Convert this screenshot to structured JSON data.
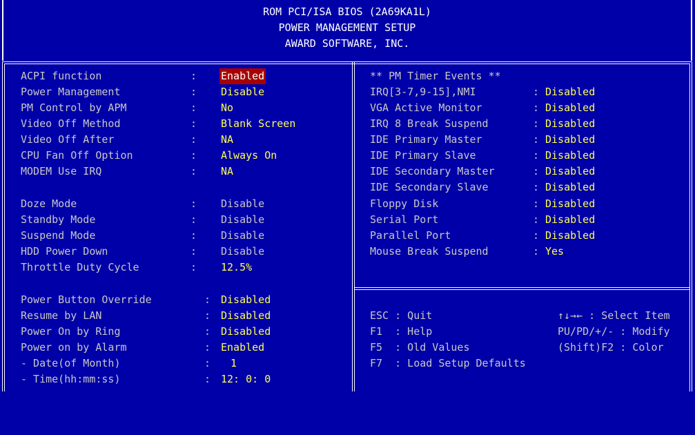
{
  "header": {
    "line1": "ROM PCI/ISA BIOS (2A69KA1L)",
    "line2": "POWER MANAGEMENT SETUP",
    "line3": "AWARD SOFTWARE, INC."
  },
  "left_group1": [
    {
      "label": "ACPI function",
      "value": "Enabled",
      "selected": true
    },
    {
      "label": "Power Management",
      "value": "Disable"
    },
    {
      "label": "PM Control by APM",
      "value": "No"
    },
    {
      "label": "Video Off Method",
      "value": "Blank Screen"
    },
    {
      "label": "Video Off After",
      "value": "NA"
    },
    {
      "label": "CPU Fan Off Option",
      "value": "Always On"
    },
    {
      "label": "MODEM Use IRQ",
      "value": "NA"
    }
  ],
  "left_group2": [
    {
      "label": "Doze Mode",
      "value": "Disable"
    },
    {
      "label": "Standby Mode",
      "value": "Disable"
    },
    {
      "label": "Suspend Mode",
      "value": "Disable"
    },
    {
      "label": "HDD Power Down",
      "value": "Disable"
    },
    {
      "label": "Throttle Duty Cycle",
      "value": "12.5%"
    }
  ],
  "left_group3": [
    {
      "label": "Power Button Override",
      "value": "Disabled"
    },
    {
      "label": "Resume by LAN",
      "value": "Disabled"
    },
    {
      "label": "Power On by Ring",
      "value": "Disabled"
    },
    {
      "label": "Power on by Alarm",
      "value": "Enabled"
    },
    {
      "label": "- Date(of Month)",
      "value": "1"
    },
    {
      "label": "- Time(hh:mm:ss)",
      "value": "12: 0: 0"
    }
  ],
  "right": {
    "title": "** PM Timer Events **",
    "items": [
      {
        "label": "IRQ[3-7,9-15],NMI",
        "value": "Disabled"
      },
      {
        "label": "VGA Active Monitor",
        "value": "Disabled"
      },
      {
        "label": "IRQ 8 Break Suspend",
        "value": "Disabled"
      },
      {
        "label": "IDE Primary Master",
        "value": "Disabled"
      },
      {
        "label": "IDE Primary Slave",
        "value": "Disabled"
      },
      {
        "label": "IDE Secondary Master",
        "value": "Disabled"
      },
      {
        "label": "IDE Secondary Slave",
        "value": "Disabled"
      },
      {
        "label": "Floppy Disk",
        "value": "Disabled"
      },
      {
        "label": "Serial Port",
        "value": "Disabled"
      },
      {
        "label": "Parallel Port",
        "value": "Disabled"
      },
      {
        "label": "Mouse Break Suspend",
        "value": "Yes"
      }
    ]
  },
  "help": {
    "esc": "ESC : Quit",
    "f1": "F1  : Help",
    "f5": "F5  : Old Values",
    "f7": "F7  : Load Setup Defaults",
    "select": "↑↓→← : Select Item",
    "modify": "PU/PD/+/- : Modify",
    "color": "(Shift)F2 : Color"
  },
  "colors": {
    "background": "#0000a8",
    "label": "#c8c8c8",
    "value": "#ffff55",
    "highlight": "#a80000",
    "border": "#ffffff"
  }
}
